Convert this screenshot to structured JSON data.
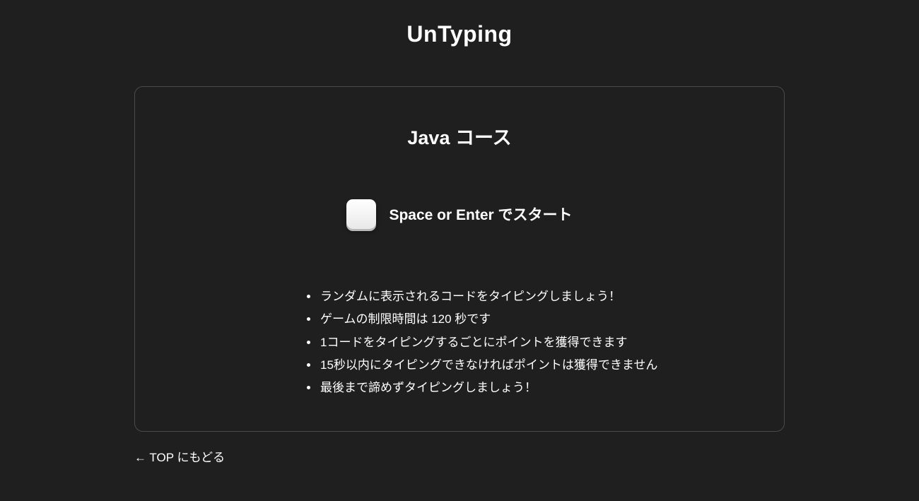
{
  "header": {
    "title": "UnTyping"
  },
  "card": {
    "course_title": "Java コース",
    "start_text": "Space or Enter でスタート"
  },
  "rules": [
    "ランダムに表示されるコードをタイピングしましょう！",
    "ゲームの制限時間は 120 秒です",
    "1コードをタイピングするごとにポイントを獲得できます",
    "15秒以内にタイピングできなければポイントは獲得できません",
    "最後まで諦めずタイピングしましょう！"
  ],
  "back_link": "← TOP にもどる"
}
